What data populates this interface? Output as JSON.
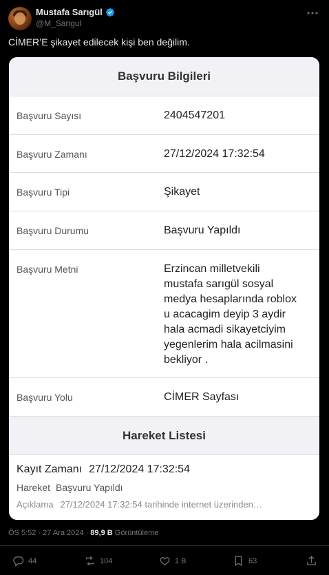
{
  "tweet": {
    "display_name": "Mustafa Sarıgül",
    "handle": "@M_Sarigul",
    "text": "CİMER’E şikayet edilecek kişi ben değilim."
  },
  "card": {
    "section1_title": "Başvuru Bilgileri",
    "rows": [
      {
        "label": "Başvuru Sayısı",
        "value": "2404547201"
      },
      {
        "label": "Başvuru Zamanı",
        "value": "27/12/2024 17:32:54"
      },
      {
        "label": "Başvuru Tipi",
        "value": "Şikayet"
      },
      {
        "label": "Başvuru Durumu",
        "value": "Başvuru Yapıldı"
      },
      {
        "label": "Başvuru Metni",
        "lines": [
          "Erzincan milletvekili",
          "mustafa sarıgül sosyal",
          "medya hesaplarında roblox",
          "u acacagim deyip 3 aydir",
          "hala acmadi sikayetciyim",
          "yegenlerim hala acilmasini",
          "bekliyor ."
        ]
      },
      {
        "label": "Başvuru Yolu",
        "value": "CİMER Sayfası"
      }
    ],
    "section2_title": "Hareket Listesi",
    "movement": {
      "time_label": "Kayıt Zamanı",
      "time_value": "27/12/2024 17:32:54",
      "action_label": "Hareket",
      "action_value": "Başvuru Yapıldı",
      "desc_label": "Açıklama",
      "desc_value": "27/12/2024 17:32:54 tarihinde internet üzerinden…"
    }
  },
  "meta": {
    "time": "ÖS 5:52",
    "sep": "·",
    "date": "27 Ara 2024",
    "views": "89,9 B",
    "views_label": "Görüntüleme"
  },
  "actions": {
    "replies": "44",
    "reposts": "104",
    "likes": "1 B",
    "bookmarks": "63"
  },
  "colors": {
    "background": "#000000",
    "verified": "#1d9bf0",
    "muted": "#71767b"
  }
}
